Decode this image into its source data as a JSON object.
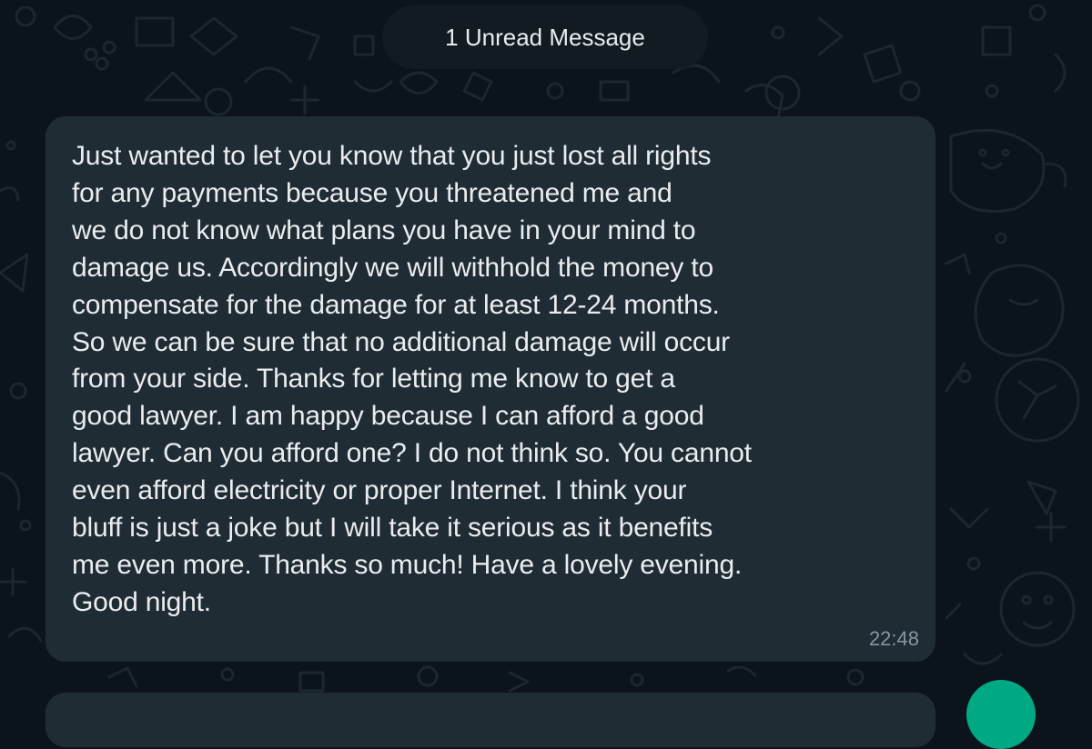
{
  "chat": {
    "unread_banner": "1 Unread Message",
    "message": {
      "text": "Just wanted to let you know that you just lost all rights\nfor any payments because you threatened me and\nwe do not know what plans you have in your mind to\ndamage us. Accordingly we will withhold the money to\ncompensate for the damage for at least 12-24 months.\nSo we can be sure that no additional damage will occur\nfrom your side. Thanks for letting me know to get a\ngood lawyer. I am happy because I can afford a good\nlawyer. Can you afford one? I do not think so. You cannot\neven afford electricity or proper Internet. I think your\nbluff is just a joke but I will take it serious as it benefits\nme even more. Thanks so much! Have a lovely evening.\nGood night.",
      "time": "22:48"
    }
  },
  "colors": {
    "background": "#0b141a",
    "bubble": "#1f2c34",
    "text": "#e9edef",
    "timestamp": "#8696a0",
    "accent": "#00a884"
  },
  "icons": [
    "doodle-wallpaper-pattern"
  ]
}
